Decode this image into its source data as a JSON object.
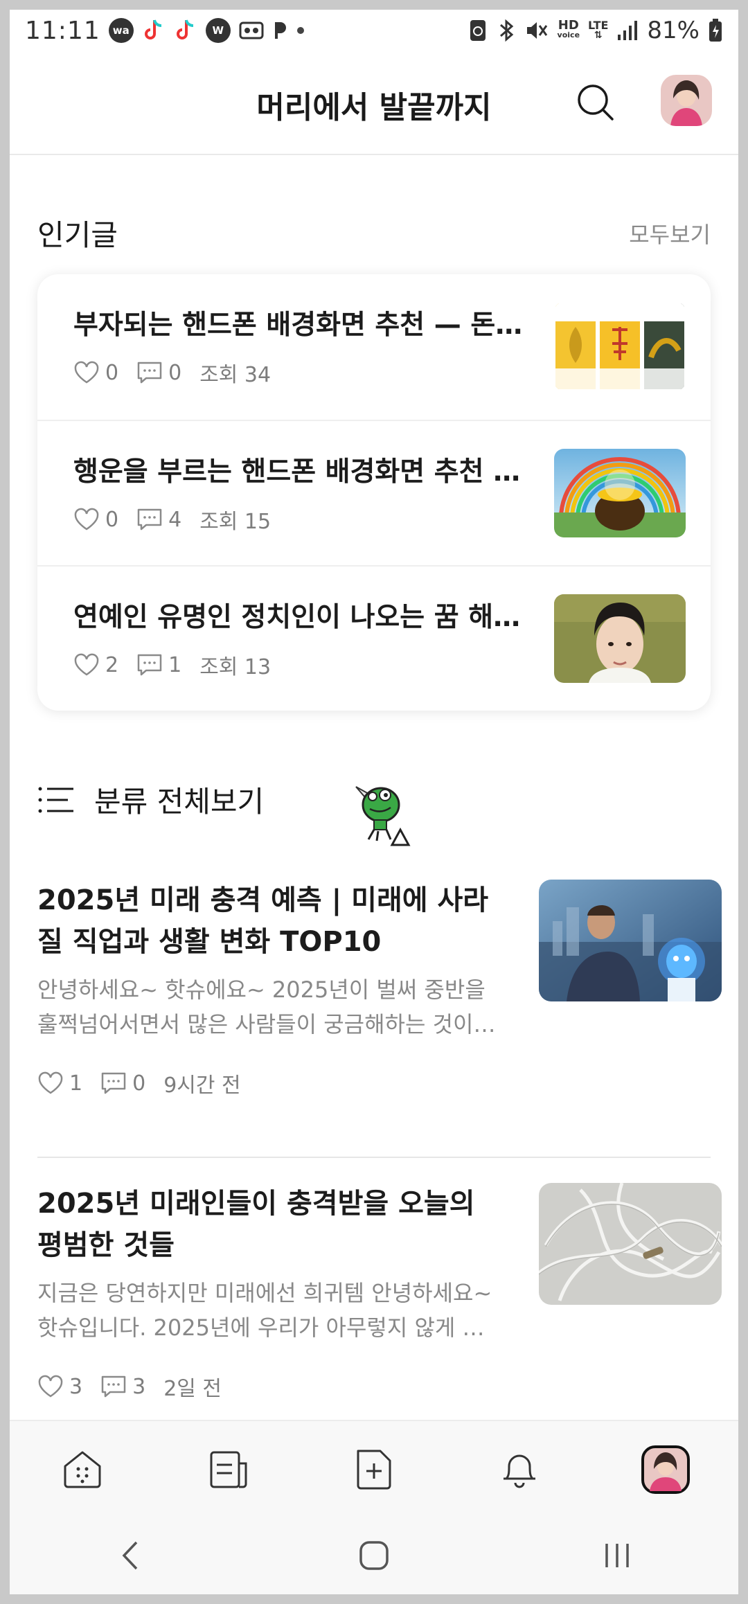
{
  "status_bar": {
    "time": "11:11",
    "battery": "81%",
    "icons": [
      "wa-icon",
      "tiktok-icon",
      "tiktok-icon",
      "w-icon",
      "cassette-icon",
      "pay-icon",
      "dot-icon",
      "recycle-icon",
      "bluetooth-icon",
      "mute-icon",
      "hd-voice-icon",
      "lte-icon",
      "signal-icon",
      "battery-icon"
    ],
    "wa_label": "wa",
    "w_label": "W",
    "hd_label": "HD",
    "voice_label": "voice",
    "lte_label": "LTE"
  },
  "header": {
    "title": "머리에서 발끝까지"
  },
  "popular": {
    "heading": "인기글",
    "see_all": "모두보기",
    "posts": [
      {
        "title": "부자되는 핸드폰 배경화면 추천 — 돈…",
        "likes": "0",
        "comments": "0",
        "views": "조회 34",
        "thumb": "gold-wallpapers"
      },
      {
        "title": "행운을 부르는 핸드폰 배경화면 추천 …",
        "likes": "0",
        "comments": "4",
        "views": "조회 15",
        "thumb": "pot-of-gold-rainbow"
      },
      {
        "title": "연예인 유명인 정치인이 나오는 꿈 해…",
        "likes": "2",
        "comments": "1",
        "views": "조회 13",
        "thumb": "celebrity-portrait"
      }
    ]
  },
  "category": {
    "label": "분류 전체보기"
  },
  "feed": [
    {
      "title": "2025년 미래 충격 예측 | 미래에 사라질 직업과 생활 변화 TOP10",
      "excerpt": "안녕하세요~ 핫슈에요~ 2025년이 벌써 중반을 훌쩍넘어서면서 많은 사람들이 궁금해하는 것이…",
      "likes": "1",
      "comments": "0",
      "time": "9시간 전"
    },
    {
      "title": "2025년 미래인들이 충격받을 오늘의 평범한 것들",
      "excerpt": "지금은 당연하지만 미래에선 희귀템 안녕하세요~ 핫슈입니다. 2025년에 우리가 아무렇지 않게 …",
      "likes": "3",
      "comments": "3",
      "time": "2일 전"
    }
  ],
  "colors": {
    "accent_text": "#1a1a1a",
    "meta_text": "#7d7d7d",
    "divider": "#e6e6e6"
  }
}
